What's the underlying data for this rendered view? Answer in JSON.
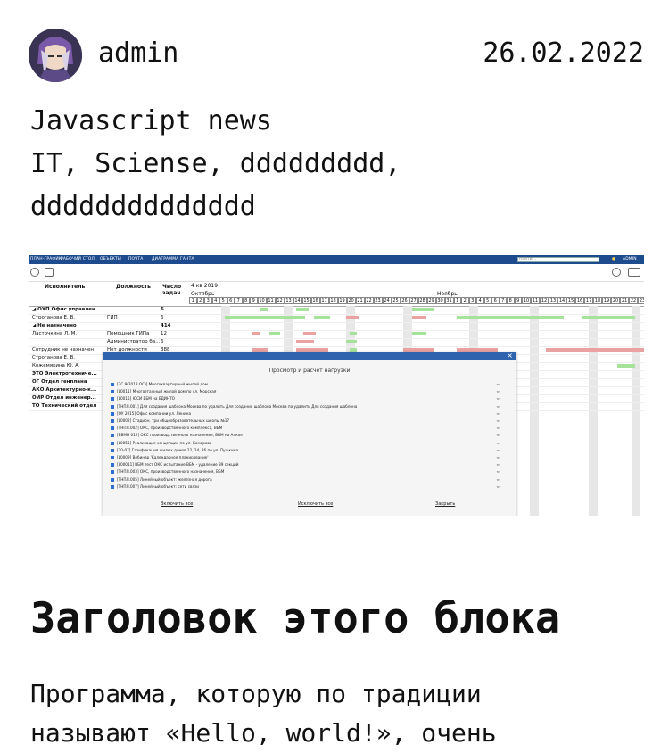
{
  "post": {
    "author": "admin",
    "date": "26.02.2022",
    "title_lines": [
      "Javascript news",
      "IT, Sciense, ddddddddd,",
      "dddddddddddddd"
    ],
    "heading": "Заголовок этого блока",
    "paragraph_lines": [
      "Программа, которую по традиции",
      "называют «Hello, world!», очень"
    ]
  },
  "screenshot": {
    "menu": [
      "ПЛАН-ГРАФИК",
      "РАБОЧИЙ СТОЛ",
      "ОБЪЕКТЫ",
      "ПОЧТА",
      "ДИАГРАММА ГАНТА"
    ],
    "search_placeholder": "найти...",
    "user": "ADMIN",
    "columns": [
      "Исполнитель",
      "Должность",
      "Число задач"
    ],
    "period": "4 кв 2019",
    "months": [
      "Октябрь",
      "Ноябрь"
    ],
    "rows": [
      {
        "name": "◢ ОУП Офис управлен...",
        "pos": "",
        "num": "6",
        "bold": true
      },
      {
        "name": "Строганова Е. В.",
        "pos": "ГИП",
        "num": "6",
        "bold": false
      },
      {
        "name": "◢ Не назначено",
        "pos": "",
        "num": "414",
        "bold": true
      },
      {
        "name": "Ласточкина Л. М.",
        "pos": "Помощник ГИПа",
        "num": "12",
        "bold": false
      },
      {
        "name": "",
        "pos": "Администратор ба...",
        "num": "6",
        "bold": false
      },
      {
        "name": "Сотрудник не назначен",
        "pos": "Нет должности",
        "num": "388",
        "bold": false
      },
      {
        "name": "Строганова Е. В.",
        "pos": "",
        "num": "",
        "bold": false
      },
      {
        "name": "Кожемякина Ю. А.",
        "pos": "",
        "num": "",
        "bold": false
      },
      {
        "name": "ЭТО Электротехниче...",
        "pos": "",
        "num": "",
        "bold": true
      },
      {
        "name": "ОГ Отдел генплана",
        "pos": "",
        "num": "",
        "bold": true
      },
      {
        "name": "АКО Архитектурно-к...",
        "pos": "",
        "num": "",
        "bold": true
      },
      {
        "name": "ОИР Отдел инженер...",
        "pos": "",
        "num": "",
        "bold": true
      },
      {
        "name": "ТО Технический отдел",
        "pos": "",
        "num": "",
        "bold": true
      }
    ],
    "dialog_title": "Просмотр и расчет нагрузки",
    "dialog_items": [
      "[ЗС 9(2018 ОС)] Многоквартирный жилой дом",
      "[L0011] Многоэтажный жилой дом по ул. Морская",
      "[L0015] ЮСИ ВБМ на ЕДИНТО",
      "[ТНПЛ.001] Для создания шаблона   Москва   по удалить Для создания шаблона   Москва   по удалить Для создания шаблона",
      "[ОУ 2015] Офис компании ул. Ленина",
      "[L0002] Стадион, три общеобразовательных школы №17",
      "[ТНПЛ.002] ОКС, производственного комплекса, ВБМ",
      "[ВБМН 012] ОКС производственного назначения, ВБМ на Алкоя",
      "[L0055] Реализация концепции по ул. Комарова",
      "[20-07] Газификация жилых домов 22, 24, 26 по ул. Пушкина",
      "[L0009] Вебинар 'Календарное планирование'",
      "[L00011] ВБМ тест ОКС испытание ВБМ - удаление 39 секций",
      "[ТНПЛ.003] ОКС, производственного назначения, ВБМ",
      "[ТНПЛ.005] Линейный объект: железная дорога",
      "[ТНПЛ.007] Линейный объект: сети связи"
    ],
    "dialog_buttons": [
      "Включить все",
      "Исключить все",
      "Закрыть"
    ]
  }
}
